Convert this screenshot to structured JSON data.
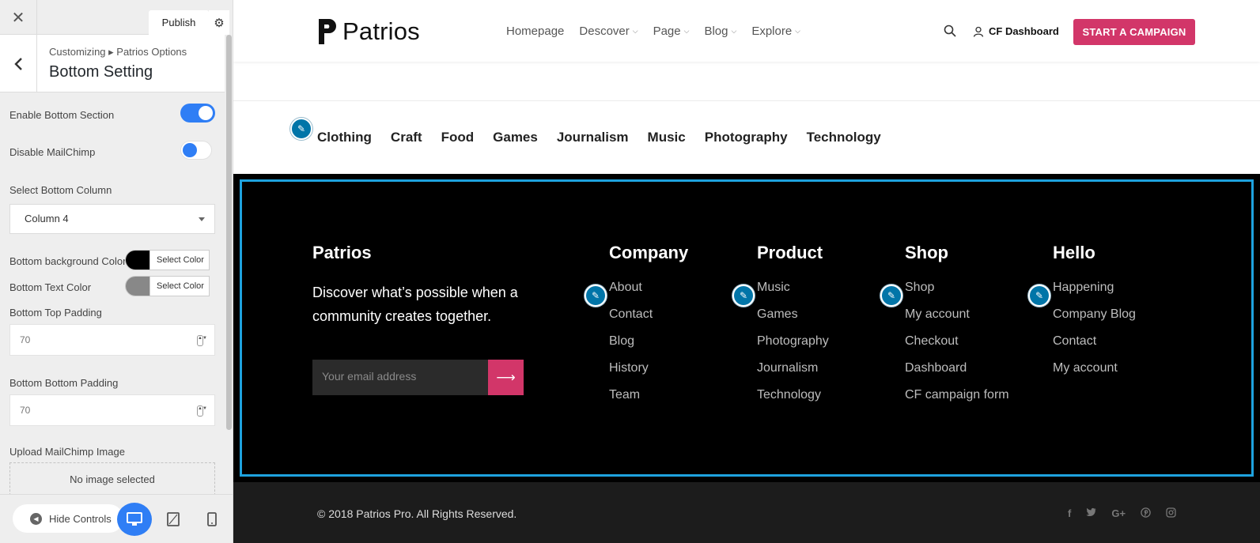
{
  "customizer": {
    "publish_label": "Publish",
    "breadcrumb": "Customizing ▸ Patrios Options",
    "section_title": "Bottom Setting",
    "enable_bottom_label": "Enable Bottom Section",
    "enable_bottom_state": true,
    "disable_mailchimp_label": "Disable MailChimp",
    "disable_mailchimp_state": false,
    "select_column_label": "Select Bottom Column",
    "select_column_value": "Column 4",
    "bg_color_label": "Bottom background Color",
    "bg_color_value": "#000000",
    "text_color_label": "Bottom Text Color",
    "text_color_value": "#888888",
    "select_color_label": "Select Color",
    "top_padding_label": "Bottom Top Padding",
    "top_padding_value": "70",
    "bottom_padding_label": "Bottom Bottom Padding",
    "bottom_padding_value": "70",
    "upload_label": "Upload MailChimp Image",
    "upload_status": "No image selected",
    "hide_controls_label": "Hide Controls"
  },
  "site": {
    "logo_text": "Patrios",
    "nav": [
      "Homepage",
      "Descover",
      "Page",
      "Blog",
      "Explore"
    ],
    "dashboard_label": "CF Dashboard",
    "cta_label": "START A CAMPAIGN",
    "categories": [
      "Clothing",
      "Craft",
      "Food",
      "Games",
      "Journalism",
      "Music",
      "Photography",
      "Technology"
    ],
    "footer": {
      "brand": "Patrios",
      "tagline": "Discover what’s possible when a community creates together.",
      "email_placeholder": "Your email address",
      "columns": [
        {
          "title": "Company",
          "links": [
            "About",
            "Contact",
            "Blog",
            "History",
            "Team"
          ]
        },
        {
          "title": "Product",
          "links": [
            "Music",
            "Games",
            "Photography",
            "Journalism",
            "Technology"
          ]
        },
        {
          "title": "Shop",
          "links": [
            "Shop",
            "My account",
            "Checkout",
            "Dashboard",
            "CF campaign form"
          ]
        },
        {
          "title": "Hello",
          "links": [
            "Happening",
            "Company Blog",
            "Contact",
            "My account"
          ]
        }
      ],
      "copyright": "© 2018 Patrios Pro. All Rights Reserved."
    },
    "social_icons": [
      "facebook-icon",
      "twitter-icon",
      "google-plus-icon",
      "pinterest-icon",
      "instagram-icon"
    ]
  },
  "colors": {
    "accent": "#d23669",
    "toggle_blue": "#2f7ef5",
    "focus_outline": "#1ea2de",
    "edit_pencil": "#0075a8"
  }
}
